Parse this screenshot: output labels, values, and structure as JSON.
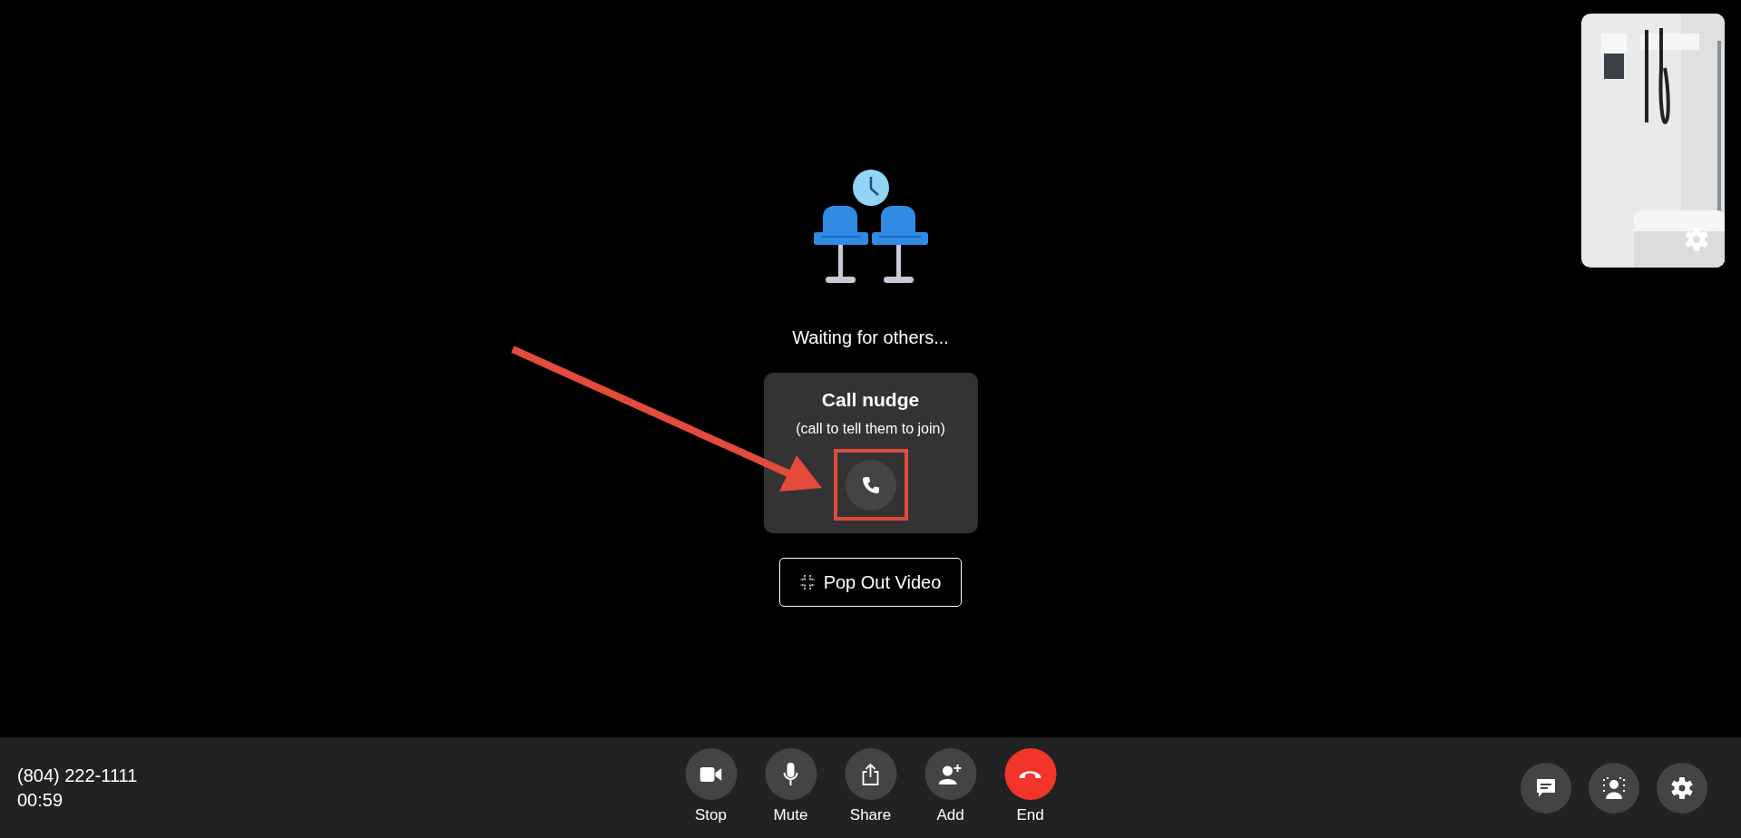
{
  "self_view": {
    "kind": "picture",
    "settings": true
  },
  "waiting_text": "Waiting for others...",
  "nudge_card": {
    "title": "Call nudge",
    "subtitle": "(call to tell them to join)",
    "highlighted": true
  },
  "pop_out_button": {
    "label": "Pop Out Video"
  },
  "annotations": [
    {
      "kind": "arrow"
    }
  ],
  "call_info": {
    "phone": "(804) 222-1111",
    "duration": "00:59"
  },
  "controls": [
    {
      "kind": "video",
      "label": "Stop"
    },
    {
      "kind": "mic",
      "label": "Mute"
    },
    {
      "kind": "share",
      "label": "Share"
    },
    {
      "kind": "add",
      "label": "Add"
    },
    {
      "kind": "end",
      "label": "End"
    }
  ],
  "side_controls": [
    {
      "kind": "chat"
    },
    {
      "kind": "background"
    },
    {
      "kind": "settings"
    }
  ]
}
